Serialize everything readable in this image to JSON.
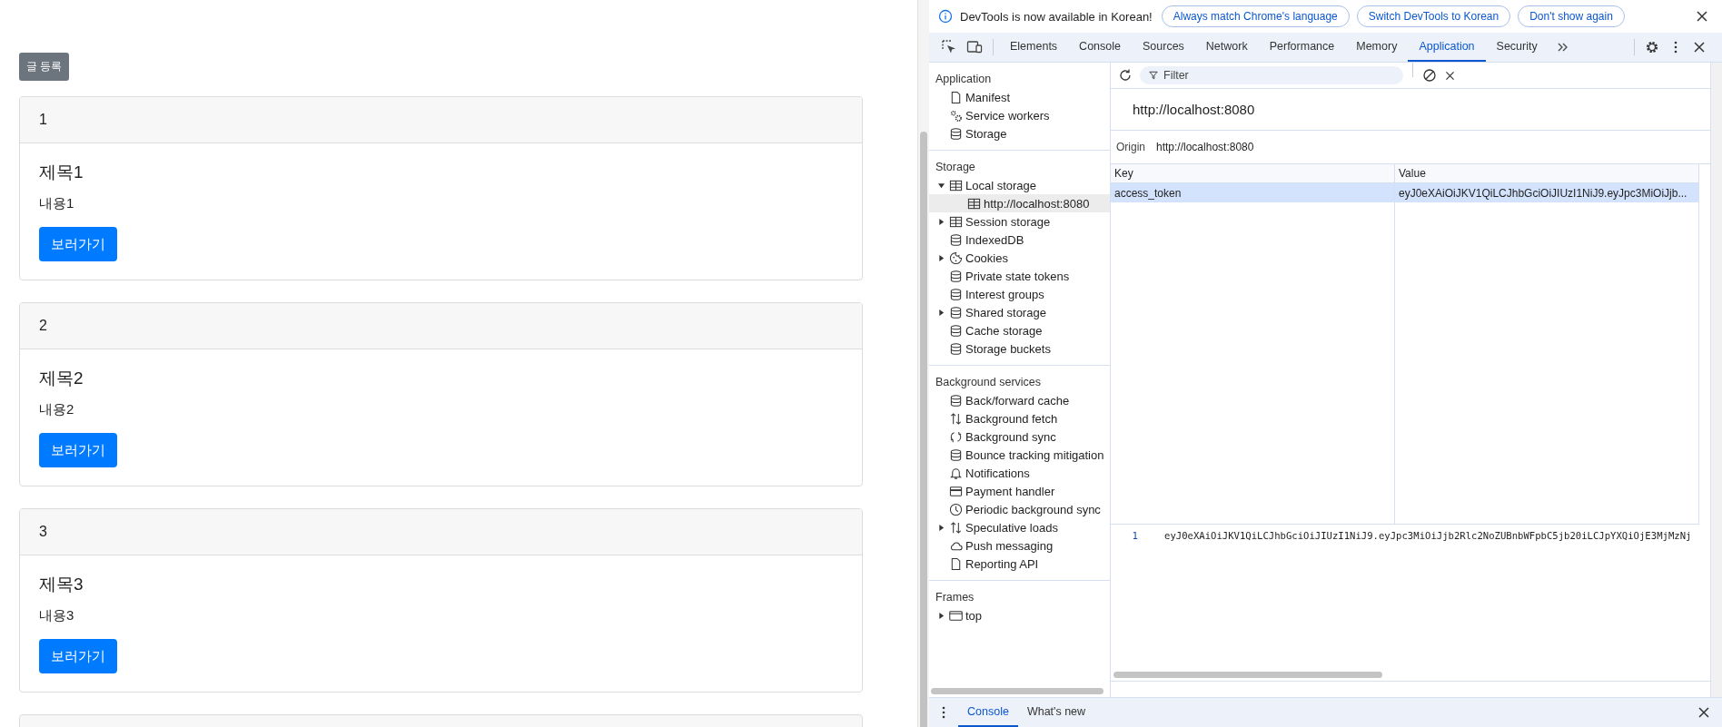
{
  "page": {
    "create_button": "글 등록",
    "posts": [
      {
        "number": "1",
        "title": "제목1",
        "content": "내용1",
        "button": "보러가기"
      },
      {
        "number": "2",
        "title": "제목2",
        "content": "내용2",
        "button": "보러가기"
      },
      {
        "number": "3",
        "title": "제목3",
        "content": "내용3",
        "button": "보러가기"
      }
    ]
  },
  "devtools": {
    "infobar": {
      "message": "DevTools is now available in Korean!",
      "buttons": [
        "Always match Chrome's language",
        "Switch DevTools to Korean",
        "Don't show again"
      ]
    },
    "tabs": [
      {
        "label": "Elements",
        "selected": false
      },
      {
        "label": "Console",
        "selected": false
      },
      {
        "label": "Sources",
        "selected": false
      },
      {
        "label": "Network",
        "selected": false
      },
      {
        "label": "Performance",
        "selected": false
      },
      {
        "label": "Memory",
        "selected": false
      },
      {
        "label": "Application",
        "selected": true
      },
      {
        "label": "Security",
        "selected": false
      }
    ],
    "sidebar": [
      {
        "title": "Application",
        "items": [
          {
            "label": "Manifest",
            "kind": "file",
            "selected": false
          },
          {
            "label": "Service workers",
            "kind": "gears",
            "selected": false
          },
          {
            "label": "Storage",
            "kind": "database",
            "selected": false
          }
        ]
      },
      {
        "title": "Storage",
        "items": [
          {
            "label": "Local storage",
            "kind": "table",
            "selected": false,
            "expanded": true,
            "children": [
              {
                "label": "http://localhost:8080",
                "kind": "table",
                "selected": true
              }
            ]
          },
          {
            "label": "Session storage",
            "kind": "table",
            "selected": false,
            "expanded": false
          },
          {
            "label": "IndexedDB",
            "kind": "database",
            "selected": false
          },
          {
            "label": "Cookies",
            "kind": "cookie",
            "selected": false,
            "expanded": false
          },
          {
            "label": "Private state tokens",
            "kind": "database",
            "selected": false
          },
          {
            "label": "Interest groups",
            "kind": "database",
            "selected": false
          },
          {
            "label": "Shared storage",
            "kind": "database",
            "selected": false,
            "expanded": false
          },
          {
            "label": "Cache storage",
            "kind": "database",
            "selected": false
          },
          {
            "label": "Storage buckets",
            "kind": "database",
            "selected": false
          }
        ]
      },
      {
        "title": "Background services",
        "items": [
          {
            "label": "Back/forward cache",
            "kind": "database",
            "selected": false
          },
          {
            "label": "Background fetch",
            "kind": "arrows",
            "selected": false
          },
          {
            "label": "Background sync",
            "kind": "sync",
            "selected": false
          },
          {
            "label": "Bounce tracking mitigation",
            "kind": "database",
            "selected": false
          },
          {
            "label": "Notifications",
            "kind": "bell",
            "selected": false
          },
          {
            "label": "Payment handler",
            "kind": "card",
            "selected": false
          },
          {
            "label": "Periodic background sync",
            "kind": "clock",
            "selected": false
          },
          {
            "label": "Speculative loads",
            "kind": "arrows",
            "selected": false,
            "expanded": false
          },
          {
            "label": "Push messaging",
            "kind": "cloud",
            "selected": false
          },
          {
            "label": "Reporting API",
            "kind": "file",
            "selected": false
          }
        ]
      },
      {
        "title": "Frames",
        "items": [
          {
            "label": "top",
            "kind": "frame",
            "selected": false,
            "expanded": false
          }
        ]
      }
    ],
    "filter": {
      "placeholder": "Filter"
    },
    "origin_title": "http://localhost:8080",
    "origin": {
      "label": "Origin",
      "value": "http://localhost:8080"
    },
    "table": {
      "columns": [
        "Key",
        "Value"
      ],
      "rows": [
        {
          "key": "access_token",
          "value": "eyJ0eXAiOiJKV1QiLCJhbGciOiJIUzI1NiJ9.eyJpc3MiOiJjb...",
          "selected": true
        }
      ]
    },
    "preview": {
      "line_number": "1",
      "text": "eyJ0eXAiOiJKV1QiLCJhbGciOiJIUzI1NiJ9.eyJpc3MiOiJjb2Rlc2NoZUBnbWFpbC5jb20iLCJpYXQiOjE3MjMzNj"
    },
    "drawer_tabs": [
      {
        "label": "Console",
        "selected": true
      },
      {
        "label": "What's new",
        "selected": false
      }
    ]
  }
}
